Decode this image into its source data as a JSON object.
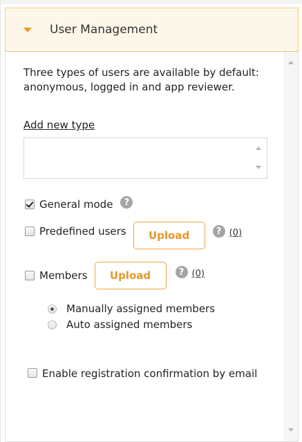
{
  "section": {
    "title": "User Management"
  },
  "description": "Three types of users are available by default: anonymous, logged in and app reviewer.",
  "add_type_link": "Add new type",
  "options": {
    "general_mode": {
      "label": "General mode",
      "checked": true
    },
    "predefined_users": {
      "label": "Predefined users",
      "checked": false,
      "upload_label": "Upload",
      "count": "(0)"
    },
    "members": {
      "label": "Members",
      "checked": false,
      "upload_label": "Upload",
      "count": "(0)"
    },
    "assignment": {
      "manual": {
        "label": "Manually assigned members",
        "selected": true
      },
      "auto": {
        "label": "Auto assigned members",
        "selected": false
      }
    },
    "registration_confirmation": {
      "label": "Enable registration confirmation by email",
      "checked": false
    }
  },
  "help_symbol": "?",
  "colors": {
    "accent": "#f09b2a",
    "header_bg": "#fdf7e9",
    "header_border": "#f2c983",
    "help_icon": "#a5a5a5"
  }
}
